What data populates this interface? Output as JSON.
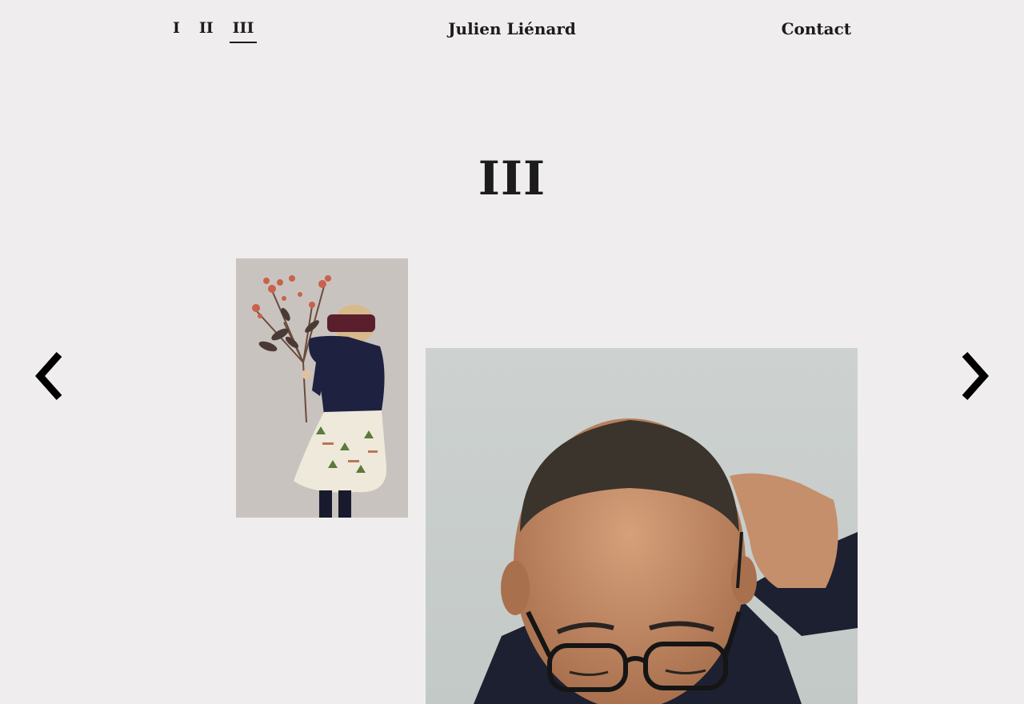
{
  "nav": {
    "items": [
      {
        "label": "I",
        "active": false
      },
      {
        "label": "II",
        "active": false
      },
      {
        "label": "III",
        "active": true
      }
    ]
  },
  "site_title": "Julien Liénard",
  "contact_label": "Contact",
  "section_title": "III",
  "icons": {
    "prev": "chevron-left-icon",
    "next": "chevron-right-icon"
  },
  "colors": {
    "background": "#efedee",
    "text": "#1c1c1c"
  }
}
